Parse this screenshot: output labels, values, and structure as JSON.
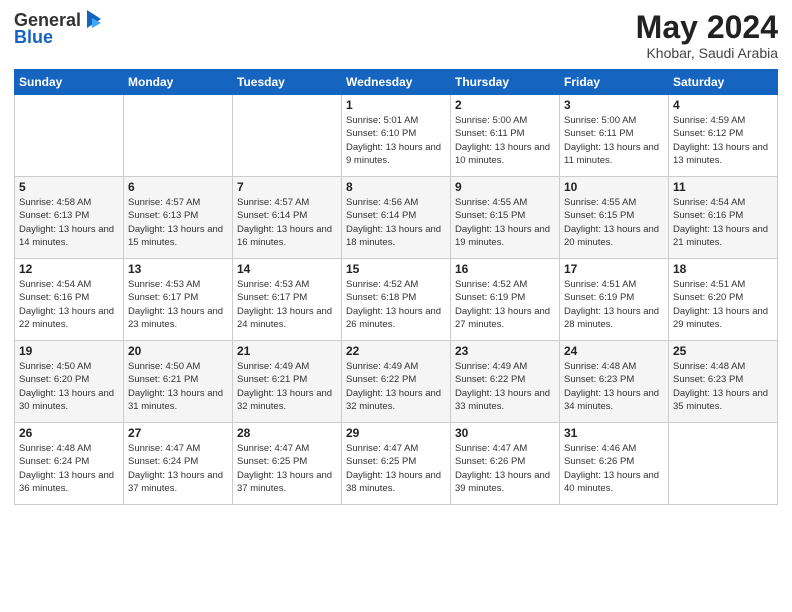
{
  "header": {
    "logo": {
      "text_general": "General",
      "text_blue": "Blue",
      "icon": "▶"
    },
    "title": "May 2024",
    "location": "Khobar, Saudi Arabia"
  },
  "weekdays": [
    "Sunday",
    "Monday",
    "Tuesday",
    "Wednesday",
    "Thursday",
    "Friday",
    "Saturday"
  ],
  "weeks": [
    [
      {
        "day": "",
        "sunrise": "",
        "sunset": "",
        "daylight": ""
      },
      {
        "day": "",
        "sunrise": "",
        "sunset": "",
        "daylight": ""
      },
      {
        "day": "",
        "sunrise": "",
        "sunset": "",
        "daylight": ""
      },
      {
        "day": "1",
        "sunrise": "Sunrise: 5:01 AM",
        "sunset": "Sunset: 6:10 PM",
        "daylight": "Daylight: 13 hours and 9 minutes."
      },
      {
        "day": "2",
        "sunrise": "Sunrise: 5:00 AM",
        "sunset": "Sunset: 6:11 PM",
        "daylight": "Daylight: 13 hours and 10 minutes."
      },
      {
        "day": "3",
        "sunrise": "Sunrise: 5:00 AM",
        "sunset": "Sunset: 6:11 PM",
        "daylight": "Daylight: 13 hours and 11 minutes."
      },
      {
        "day": "4",
        "sunrise": "Sunrise: 4:59 AM",
        "sunset": "Sunset: 6:12 PM",
        "daylight": "Daylight: 13 hours and 13 minutes."
      }
    ],
    [
      {
        "day": "5",
        "sunrise": "Sunrise: 4:58 AM",
        "sunset": "Sunset: 6:13 PM",
        "daylight": "Daylight: 13 hours and 14 minutes."
      },
      {
        "day": "6",
        "sunrise": "Sunrise: 4:57 AM",
        "sunset": "Sunset: 6:13 PM",
        "daylight": "Daylight: 13 hours and 15 minutes."
      },
      {
        "day": "7",
        "sunrise": "Sunrise: 4:57 AM",
        "sunset": "Sunset: 6:14 PM",
        "daylight": "Daylight: 13 hours and 16 minutes."
      },
      {
        "day": "8",
        "sunrise": "Sunrise: 4:56 AM",
        "sunset": "Sunset: 6:14 PM",
        "daylight": "Daylight: 13 hours and 18 minutes."
      },
      {
        "day": "9",
        "sunrise": "Sunrise: 4:55 AM",
        "sunset": "Sunset: 6:15 PM",
        "daylight": "Daylight: 13 hours and 19 minutes."
      },
      {
        "day": "10",
        "sunrise": "Sunrise: 4:55 AM",
        "sunset": "Sunset: 6:15 PM",
        "daylight": "Daylight: 13 hours and 20 minutes."
      },
      {
        "day": "11",
        "sunrise": "Sunrise: 4:54 AM",
        "sunset": "Sunset: 6:16 PM",
        "daylight": "Daylight: 13 hours and 21 minutes."
      }
    ],
    [
      {
        "day": "12",
        "sunrise": "Sunrise: 4:54 AM",
        "sunset": "Sunset: 6:16 PM",
        "daylight": "Daylight: 13 hours and 22 minutes."
      },
      {
        "day": "13",
        "sunrise": "Sunrise: 4:53 AM",
        "sunset": "Sunset: 6:17 PM",
        "daylight": "Daylight: 13 hours and 23 minutes."
      },
      {
        "day": "14",
        "sunrise": "Sunrise: 4:53 AM",
        "sunset": "Sunset: 6:17 PM",
        "daylight": "Daylight: 13 hours and 24 minutes."
      },
      {
        "day": "15",
        "sunrise": "Sunrise: 4:52 AM",
        "sunset": "Sunset: 6:18 PM",
        "daylight": "Daylight: 13 hours and 26 minutes."
      },
      {
        "day": "16",
        "sunrise": "Sunrise: 4:52 AM",
        "sunset": "Sunset: 6:19 PM",
        "daylight": "Daylight: 13 hours and 27 minutes."
      },
      {
        "day": "17",
        "sunrise": "Sunrise: 4:51 AM",
        "sunset": "Sunset: 6:19 PM",
        "daylight": "Daylight: 13 hours and 28 minutes."
      },
      {
        "day": "18",
        "sunrise": "Sunrise: 4:51 AM",
        "sunset": "Sunset: 6:20 PM",
        "daylight": "Daylight: 13 hours and 29 minutes."
      }
    ],
    [
      {
        "day": "19",
        "sunrise": "Sunrise: 4:50 AM",
        "sunset": "Sunset: 6:20 PM",
        "daylight": "Daylight: 13 hours and 30 minutes."
      },
      {
        "day": "20",
        "sunrise": "Sunrise: 4:50 AM",
        "sunset": "Sunset: 6:21 PM",
        "daylight": "Daylight: 13 hours and 31 minutes."
      },
      {
        "day": "21",
        "sunrise": "Sunrise: 4:49 AM",
        "sunset": "Sunset: 6:21 PM",
        "daylight": "Daylight: 13 hours and 32 minutes."
      },
      {
        "day": "22",
        "sunrise": "Sunrise: 4:49 AM",
        "sunset": "Sunset: 6:22 PM",
        "daylight": "Daylight: 13 hours and 32 minutes."
      },
      {
        "day": "23",
        "sunrise": "Sunrise: 4:49 AM",
        "sunset": "Sunset: 6:22 PM",
        "daylight": "Daylight: 13 hours and 33 minutes."
      },
      {
        "day": "24",
        "sunrise": "Sunrise: 4:48 AM",
        "sunset": "Sunset: 6:23 PM",
        "daylight": "Daylight: 13 hours and 34 minutes."
      },
      {
        "day": "25",
        "sunrise": "Sunrise: 4:48 AM",
        "sunset": "Sunset: 6:23 PM",
        "daylight": "Daylight: 13 hours and 35 minutes."
      }
    ],
    [
      {
        "day": "26",
        "sunrise": "Sunrise: 4:48 AM",
        "sunset": "Sunset: 6:24 PM",
        "daylight": "Daylight: 13 hours and 36 minutes."
      },
      {
        "day": "27",
        "sunrise": "Sunrise: 4:47 AM",
        "sunset": "Sunset: 6:24 PM",
        "daylight": "Daylight: 13 hours and 37 minutes."
      },
      {
        "day": "28",
        "sunrise": "Sunrise: 4:47 AM",
        "sunset": "Sunset: 6:25 PM",
        "daylight": "Daylight: 13 hours and 37 minutes."
      },
      {
        "day": "29",
        "sunrise": "Sunrise: 4:47 AM",
        "sunset": "Sunset: 6:25 PM",
        "daylight": "Daylight: 13 hours and 38 minutes."
      },
      {
        "day": "30",
        "sunrise": "Sunrise: 4:47 AM",
        "sunset": "Sunset: 6:26 PM",
        "daylight": "Daylight: 13 hours and 39 minutes."
      },
      {
        "day": "31",
        "sunrise": "Sunrise: 4:46 AM",
        "sunset": "Sunset: 6:26 PM",
        "daylight": "Daylight: 13 hours and 40 minutes."
      },
      {
        "day": "",
        "sunrise": "",
        "sunset": "",
        "daylight": ""
      }
    ]
  ]
}
